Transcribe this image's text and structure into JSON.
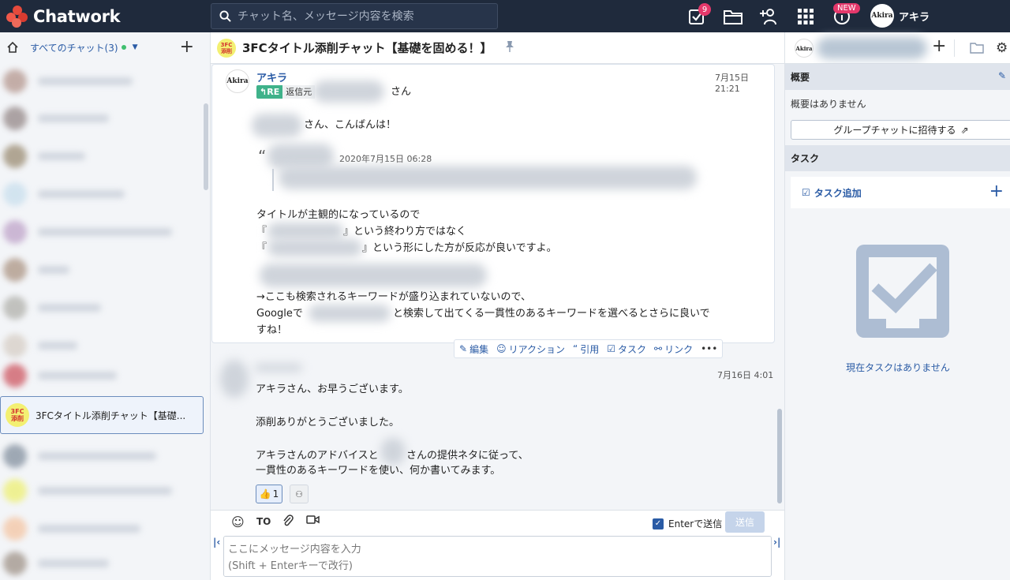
{
  "app": {
    "name": "Chatwork"
  },
  "search": {
    "placeholder": "チャット名、メッセージ内容を検索"
  },
  "topbar": {
    "task_badge": "9",
    "new_badge": "NEW",
    "user_name": "アキラ",
    "user_avatar_text": "Akira"
  },
  "sidebar": {
    "title": "すべてのチャット(3)",
    "active_room_label": "3FCタイトル添削チャット【基礎...",
    "room_icon_text": "3FC\n添削"
  },
  "room": {
    "title": "3FCタイトル添削チャット【基礎を固める！】"
  },
  "message1": {
    "sender": "アキラ",
    "time": "7月15日 21:21",
    "re_label": "RE",
    "re_text": "返信元",
    "re_suffix": "さん",
    "greeting": "さん、こんばんは！",
    "quote_time": "2020年7月15日 06:28",
    "line1": "タイトルが主観的になっているので",
    "line2_prefix": "『",
    "line2_suffix": "』という終わり方ではなく",
    "line3_prefix": "『",
    "line3_suffix": "』という形にした方が反応が良いですよ。",
    "line4": "→ここも検索されるキーワードが盛り込まれていないので、",
    "line5_prefix": "Googleで",
    "line5_suffix": "と検索して出てくる一貫性のあるキーワードを選べるとさらに良いで",
    "line6": "すね！"
  },
  "actions": {
    "edit": "編集",
    "reaction": "リアクション",
    "quote": "引用",
    "task": "タスク",
    "link": "リンク",
    "more": "•••"
  },
  "message2": {
    "time": "7月16日 4:01",
    "line1": "アキラさん、お早うございます。",
    "line2": "添削ありがとうございました。",
    "line3_prefix": "アキラさんのアドバイスと",
    "line3_suffix": "さんの提供ネタに従って、",
    "line4": "一貫性のあるキーワードを使い、何か書いてみます。",
    "reaction_count": "1"
  },
  "composer": {
    "to_label": "TO",
    "enter_send_label": "Enterで送信",
    "send_label": "送信",
    "placeholder": "ここにメッセージ内容を入力\n(Shift + Enterキーで改行)"
  },
  "right": {
    "overview_title": "概要",
    "overview_text": "概要はありません",
    "invite_label": "グループチャットに招待する",
    "task_title": "タスク",
    "task_add_label": "タスク追加",
    "no_task_text": "現在タスクはありません"
  },
  "colors": {
    "topbar": "#1f2a3c",
    "accent": "#2a5ba5",
    "badge": "#e4386b",
    "re_tag": "#3fb28a"
  }
}
